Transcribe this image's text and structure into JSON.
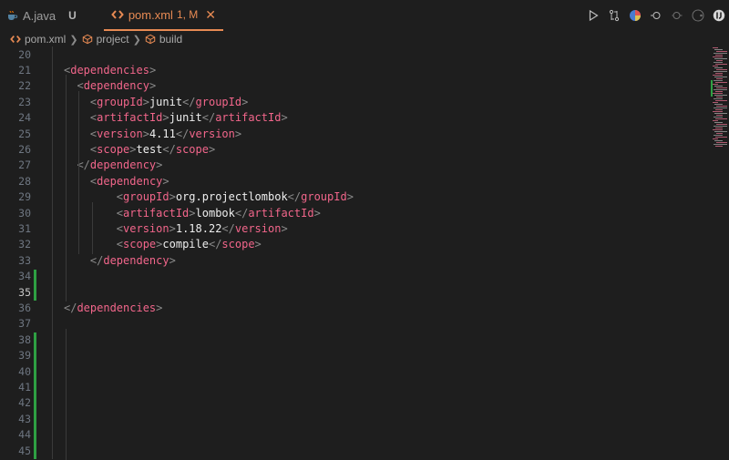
{
  "tabs": [
    {
      "label": "A.java",
      "status": "U",
      "icon": "java-cup-icon",
      "active": false
    },
    {
      "label": "pom.xml",
      "status": "1, M",
      "icon": "xml-brackets-icon",
      "active": true,
      "close": "✕"
    }
  ],
  "toolbar": {
    "icons": [
      "run-icon",
      "compare-changes-icon",
      "color-picker-icon",
      "go-back-icon",
      "go-forward-icon",
      "more-actions-icon"
    ]
  },
  "breadcrumb": [
    {
      "label": "pom.xml",
      "icon": "xml-brackets-icon"
    },
    {
      "label": "project",
      "icon": "cube-icon"
    },
    {
      "label": "build",
      "icon": "cube-icon"
    }
  ],
  "editor": {
    "lines": [
      {
        "n": "20",
        "code": ""
      },
      {
        "n": "21",
        "code": "<dependencies>"
      },
      {
        "n": "22",
        "code": "  <dependency>"
      },
      {
        "n": "23",
        "code": "    <groupId>junit</groupId>"
      },
      {
        "n": "24",
        "code": "    <artifactId>junit</artifactId>"
      },
      {
        "n": "25",
        "code": "    <version>4.11</version>"
      },
      {
        "n": "26",
        "code": "    <scope>test</scope>"
      },
      {
        "n": "27",
        "code": "  </dependency>"
      },
      {
        "n": "28",
        "code": "    <dependency>"
      },
      {
        "n": "29",
        "code": "        <groupId>org.projectlombok</groupId>"
      },
      {
        "n": "30",
        "code": "        <artifactId>lombok</artifactId>"
      },
      {
        "n": "31",
        "code": "        <version>1.18.22</version>"
      },
      {
        "n": "32",
        "code": "        <scope>compile</scope>"
      },
      {
        "n": "33",
        "code": "    </dependency>"
      },
      {
        "n": "34",
        "code": ""
      },
      {
        "n": "35",
        "code": ""
      },
      {
        "n": "36",
        "code": "</dependencies>"
      },
      {
        "n": "37",
        "code": ""
      },
      {
        "n": "38",
        "code": ""
      },
      {
        "n": "39",
        "code": ""
      },
      {
        "n": "40",
        "code": ""
      },
      {
        "n": "41",
        "code": ""
      },
      {
        "n": "42",
        "code": ""
      },
      {
        "n": "43",
        "code": ""
      },
      {
        "n": "44",
        "code": ""
      },
      {
        "n": "45",
        "code": ""
      }
    ]
  },
  "colors": {
    "accent": "#e78a53",
    "added": "#2ea043",
    "tag": "#f2668b"
  }
}
